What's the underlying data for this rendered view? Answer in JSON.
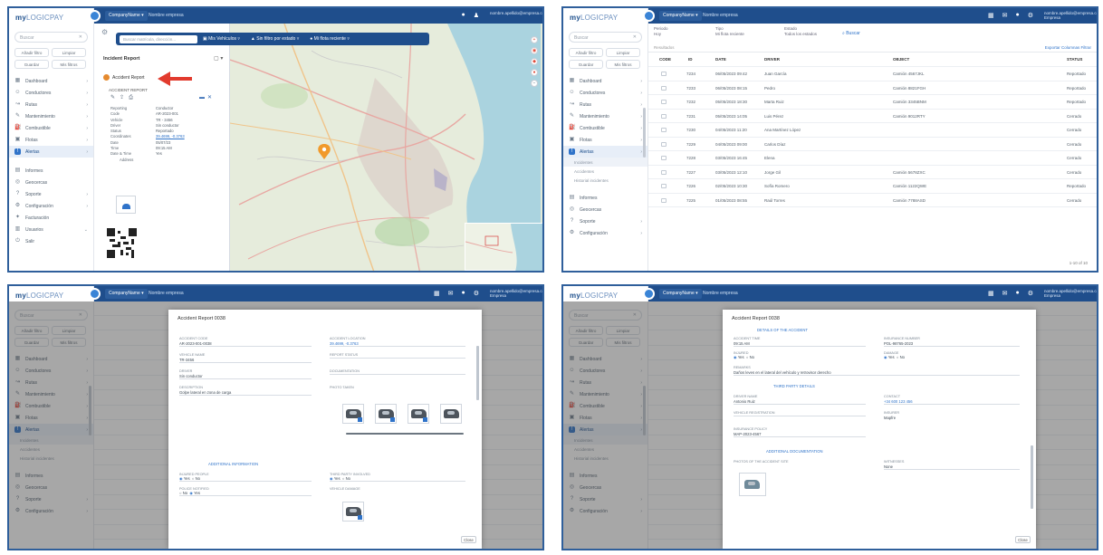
{
  "app": {
    "brand_bold": "my",
    "brand_thin": "LOGICPAY",
    "topbar_select": "CompanyName",
    "topbar_select_short": "CompanyName",
    "topbar_text1": "Nombre empresa",
    "topbar_text2": "Nombre empresa",
    "user_line1": "nombre.apellido@empresa.com",
    "user_line2": "Empresa",
    "search_placeholder": "Buscar",
    "chips": [
      "Añadir filtro",
      "Limpiar",
      "Guardar",
      "Mis filtros"
    ],
    "menu": [
      {
        "label": "Dashboard",
        "icon": "dashboard-icon"
      },
      {
        "label": "Conductores",
        "icon": "user-icon"
      },
      {
        "label": "Rutas",
        "icon": "route-icon"
      },
      {
        "label": "Mantenimiento",
        "icon": "wrench-icon"
      },
      {
        "label": "Combustible",
        "icon": "fuel-icon"
      },
      {
        "label": "Flotas",
        "icon": "truck-icon"
      },
      {
        "label": "Alertas",
        "icon": "alert-icon"
      }
    ],
    "menu_extra": [
      {
        "label": "Informes",
        "icon": "report-icon"
      },
      {
        "label": "Geocercas",
        "icon": "location-icon"
      },
      {
        "label": "Soporte",
        "icon": "help-icon"
      },
      {
        "label": "Configuración",
        "icon": "settings-icon"
      },
      {
        "label": "Facturación",
        "icon": "bill-icon"
      },
      {
        "label": "Usuarios",
        "icon": "users-icon"
      },
      {
        "label": "Salir",
        "icon": "logout-icon"
      }
    ],
    "submenu": [
      "Incidentes",
      "Accidentes",
      "Historial incidentes"
    ]
  },
  "screen1": {
    "filter_search": "Buscar matrícula, dirección...",
    "filter_items": [
      "Mis Vehículos",
      "Sin filtro por estado",
      "Mi flota reciente"
    ],
    "panel_title": "Incident Report",
    "selected": "Accident Report",
    "subhead": "ACCIDENT REPORT",
    "details": [
      {
        "k": "Reporting",
        "v": "Conductor"
      },
      {
        "k": "Code",
        "v": "AR-2023-001"
      },
      {
        "k": "Vehicle",
        "v": "TR - 3456"
      },
      {
        "k": "Driver",
        "v": "Sin conductor"
      },
      {
        "k": "Status",
        "v": "Reportado"
      },
      {
        "k": "Coordinates",
        "v": "39.4699, -0.3763",
        "link": true
      },
      {
        "k": "Date",
        "v": "05/07/23"
      },
      {
        "k": "Time",
        "v": "09:15 AM"
      },
      {
        "k": "Date & Time",
        "v": "Yes"
      },
      {
        "k": "Address",
        "v": ""
      }
    ]
  },
  "screen2": {
    "filter1_label": "Periodo",
    "filter1_value": "Hoy",
    "filter2_label": "Tipo",
    "filter2_value": "Mi flota reciente",
    "filter3_label": "Estado",
    "filter3_value": "Todos los estados",
    "go_label": "Buscar",
    "results": "Resultados",
    "actions": "Exportar  Columnas  Filtrar",
    "headers": [
      "CODE",
      "ID",
      "DATE",
      "DRIVER",
      "OBJECT",
      "STATUS"
    ],
    "rows": [
      {
        "code": "7234",
        "date": "06/05/2023 09:42",
        "driver": "Juan García",
        "obj": "Camión 4567JKL",
        "status": "Reportado"
      },
      {
        "code": "7233",
        "date": "06/05/2023 08:15",
        "driver": "Pedro",
        "obj": "Camión 8821FGH",
        "status": "Reportado"
      },
      {
        "code": "7232",
        "date": "05/05/2023 18:30",
        "driver": "Marta Ruiz",
        "obj": "Camión 3345BNM",
        "status": "Reportado"
      },
      {
        "code": "7231",
        "date": "05/05/2023 14:05",
        "driver": "Luis Pérez",
        "obj": "Camión 9012RTY",
        "status": "Cerrado"
      },
      {
        "code": "7230",
        "date": "04/05/2023 11:20",
        "driver": "Ana Martínez López",
        "obj": "",
        "status": "Cerrado"
      },
      {
        "code": "7229",
        "date": "04/05/2023 09:00",
        "driver": "Carlos Díaz",
        "obj": "",
        "status": "Cerrado"
      },
      {
        "code": "7228",
        "date": "03/05/2023 16:45",
        "driver": "Elena",
        "obj": "",
        "status": "Cerrado"
      },
      {
        "code": "7227",
        "date": "03/05/2023 12:10",
        "driver": "Jorge Gil",
        "obj": "Camión 5678ZXC",
        "status": "Cerrado"
      },
      {
        "code": "7226",
        "date": "02/05/2023 10:30",
        "driver": "Sofía Romero",
        "obj": "Camión 1122QWE",
        "status": "Reportado"
      },
      {
        "code": "7225",
        "date": "01/05/2023 08:55",
        "driver": "Raúl Torres",
        "obj": "Camión 7788ASD",
        "status": "Cerrado"
      }
    ],
    "pager": "1-10 of 10"
  },
  "screen3": {
    "title": "Accident Report 0038",
    "fields_left": [
      {
        "lbl": "ACCIDENT CODE",
        "val": "AR-2023-001-0038"
      },
      {
        "lbl": "VEHICLE NAME",
        "val": "TR-3456"
      },
      {
        "lbl": "DRIVER",
        "val": "Sin conductor"
      },
      {
        "lbl": "DESCRIPTION",
        "val": "Golpe lateral en zona de carga"
      }
    ],
    "fields_right": [
      {
        "lbl": "ACCIDENT LOCATION",
        "val": "39.4699, -0.3763",
        "link": true
      },
      {
        "lbl": "REPORT STATUS",
        "val": ""
      },
      {
        "lbl": "DOCUMENTATION",
        "val": ""
      },
      {
        "lbl": "PHOTO TAKEN",
        "val": ""
      }
    ],
    "section": "ADDITIONAL INFORMATION",
    "q1": "INJURED PEOPLE",
    "q2": "POLICE NOTIFIED",
    "q3": "THIRD PARTY INVOLVED",
    "q4": "VEHICLE DAMAGE",
    "yes": "Yes",
    "no": "No",
    "close": "Close"
  },
  "screen4": {
    "title": "Accident Report 0038",
    "section1": "DETAILS OF THE ACCIDENT",
    "f1": {
      "lbl": "ACCIDENT TIME",
      "val": "09:15 AM"
    },
    "f2": {
      "lbl": "INSURANCE NUMBER",
      "val": "POL-98765-2023"
    },
    "f3": {
      "lbl": "INJURED",
      "val": ""
    },
    "f4": {
      "lbl": "DAMAGE",
      "val": ""
    },
    "f5": {
      "lbl": "REMARKS",
      "val": "Daños leves en el lateral del vehículo y retrovisor derecho"
    },
    "section2": "THIRD PARTY DETAILS",
    "f6": {
      "lbl": "DRIVER NAME",
      "val": "Antonio Ruiz"
    },
    "f7": {
      "lbl": "CONTACT",
      "val": "+34 600 123 456",
      "link": true
    },
    "f8": {
      "lbl": "VEHICLE REGISTRATION",
      "val": ""
    },
    "f9": {
      "lbl": "INSURER",
      "val": "Mapfre"
    },
    "f10": {
      "lbl": "INSURANCE POLICY",
      "val": "MAP-2023-4567"
    },
    "section3": "ADDITIONAL DOCUMENTATION",
    "f11": {
      "lbl": "PHOTOS OF THE ACCIDENT SITE",
      "val": ""
    },
    "f12": {
      "lbl": "WITNESSES",
      "val": "None"
    },
    "yes": "Yes",
    "no": "No",
    "close": "Close"
  }
}
